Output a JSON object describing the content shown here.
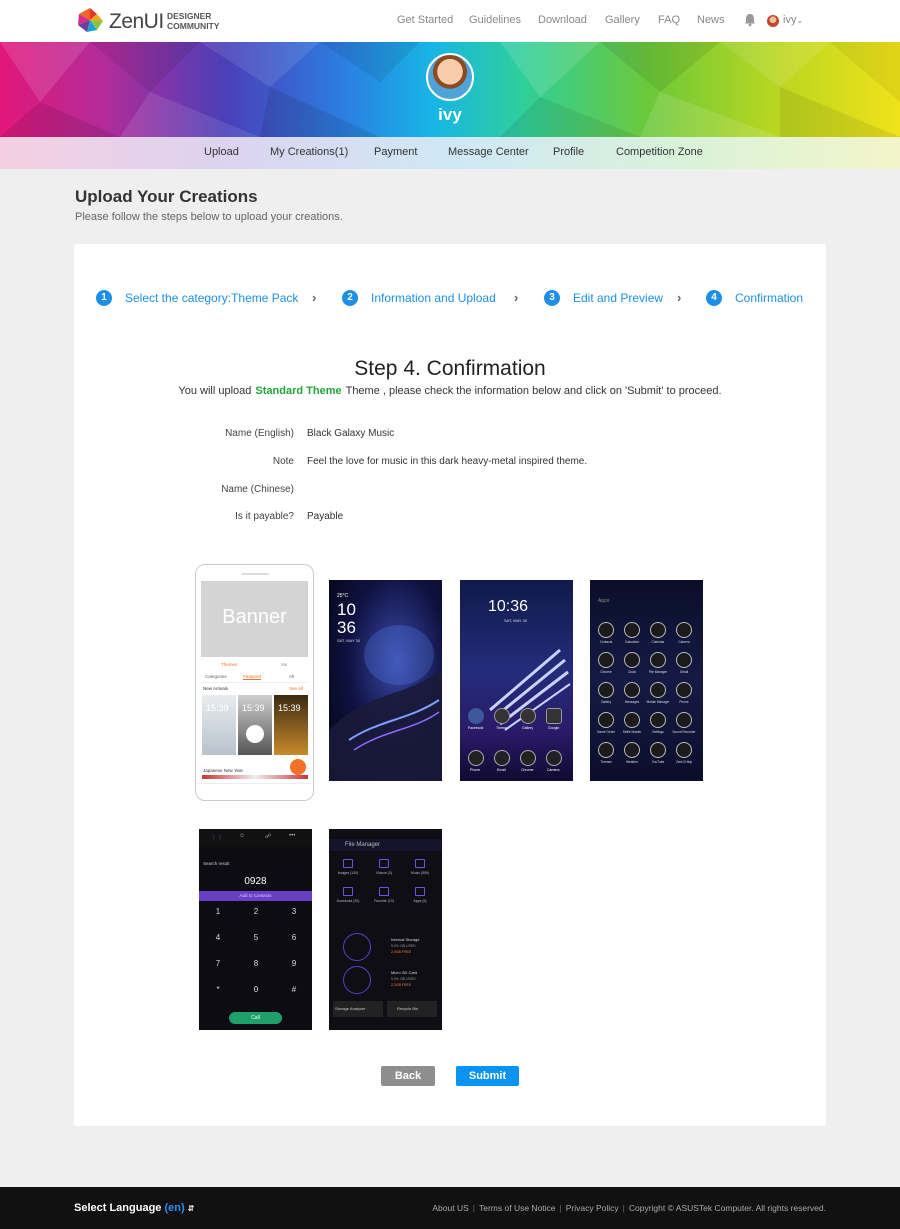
{
  "colors": {
    "accent": "#1e8fe6",
    "green": "#22a33a",
    "footer": "#111111",
    "submit": "#0a93f0",
    "back": "#8e8e8e"
  },
  "header": {
    "logo_text": "ZenUI",
    "logo_sub_1": "DESIGNER",
    "logo_sub_2": "COMMUNITY",
    "nav": [
      "Get Started",
      "Guidelines",
      "Download",
      "Gallery",
      "FAQ",
      "News"
    ],
    "bell_icon": "bell-icon",
    "user_name": "ivy"
  },
  "profile": {
    "name": "ivy"
  },
  "subnav": [
    "Upload",
    "My Creations(1)",
    "Payment",
    "Message Center",
    "Profile",
    "Competition Zone"
  ],
  "page": {
    "title": "Upload Your Creations",
    "subtitle": "Please follow the steps below to upload your creations."
  },
  "steps": [
    {
      "num": "1",
      "label": "Select the category:Theme Pack"
    },
    {
      "num": "2",
      "label": "Information and Upload"
    },
    {
      "num": "3",
      "label": "Edit and Preview"
    },
    {
      "num": "4",
      "label": "Confirmation"
    }
  ],
  "confirm": {
    "title": "Step 4. Confirmation",
    "desc_pre": "You will upload",
    "desc_type": "Standard Theme",
    "desc_post": "Theme , please check the information below and click on 'Submit' to proceed.",
    "fields": [
      {
        "label": "Name (English)",
        "value": "Black Galaxy Music"
      },
      {
        "label": "Note",
        "value": "Feel the love for music in this dark heavy-metal inspired theme."
      },
      {
        "label": "Name (Chinese)",
        "value": ""
      },
      {
        "label": "Is it payable?",
        "value": "Payable"
      }
    ]
  },
  "previews": {
    "store": {
      "banner": "Banner",
      "tab_themes": "Themes",
      "tab_me": "Me",
      "cat_categories": "Categories",
      "cat_featured": "Featured",
      "cat_all": "All",
      "new_arrivals": "New Arrivals",
      "see_all": "See all",
      "time_1": "15:39",
      "time_2": "15:39",
      "time_3": "15:39",
      "japanese": "Japanese New Year"
    },
    "lock": {
      "temp": "25°C",
      "hour": "10",
      "min": "36",
      "date": "SAT, MAY 30"
    },
    "home": {
      "clock": "10:36",
      "date": "SAT, MAY 30",
      "apps": [
        "Facebook",
        "Theme",
        "Gallery",
        "Google",
        "Phone",
        "Email",
        "Chrome",
        "Camera"
      ]
    },
    "drawer": {
      "search": "Apps",
      "apps": [
        "Contacts",
        "Calculator",
        "Calendar",
        "Camera",
        "Chrome",
        "Clock",
        "File Manager",
        "Gmail",
        "Gallery",
        "Messages",
        "Mobile Manager",
        "Phone",
        "Game Genie",
        "Selfie Master",
        "Settings",
        "Sound Recorder",
        "Themes",
        "Weather",
        "YouTube",
        "ZenUI Help"
      ]
    },
    "dialer": {
      "search_result": "Search result",
      "number": "0928",
      "add_contacts": "Add to Contacts",
      "keys": [
        "1",
        "2",
        "3",
        "4",
        "5",
        "6",
        "7",
        "8",
        "9",
        "*",
        "0",
        "#"
      ],
      "call": "Call"
    },
    "files": {
      "title": "File Manager",
      "cats": [
        "Images (130)",
        "Videos (3)",
        "Music (590)",
        "Download (20)",
        "Favorite (10)",
        "Apps (6)"
      ],
      "internal": "Internal Storage",
      "internal_used": "5.0% OB USED",
      "internal_free": "2.3GB FREE",
      "sd": "Micro SD Card",
      "sd_used": "5.0% OB USED",
      "sd_free": "2.3GB FREE",
      "analyzer": "Storage Analyzer",
      "recycle": "Recycle Bin"
    }
  },
  "buttons": {
    "back": "Back",
    "submit": "Submit"
  },
  "footer": {
    "select_language": "Select Language",
    "lang_code": "(en)",
    "links": [
      "About US",
      "Terms of Use Notice",
      "Privacy Policy",
      "Copyright © ASUSTek Computer. All rights reserved."
    ]
  }
}
